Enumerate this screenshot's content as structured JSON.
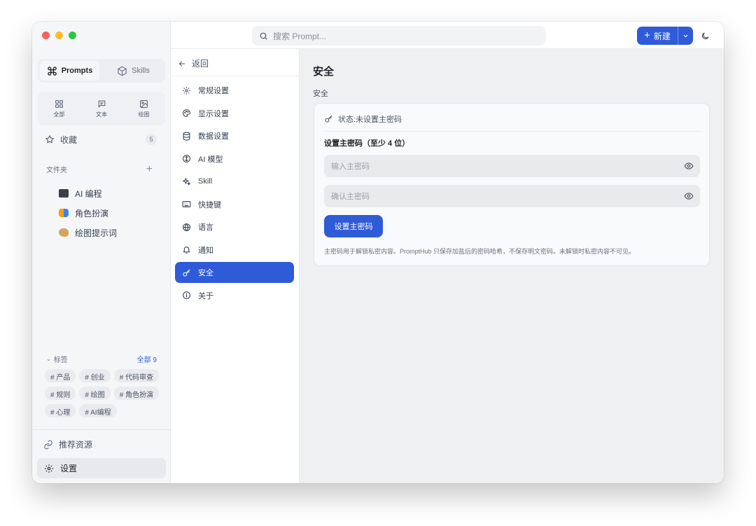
{
  "sidebar": {
    "mode_tabs": [
      {
        "label": "Prompts",
        "icon": "command-icon",
        "active": true
      },
      {
        "label": "Skills",
        "icon": "cube-icon",
        "active": false
      }
    ],
    "type_filters": [
      {
        "label": "全部",
        "icon": "grid-icon"
      },
      {
        "label": "文本",
        "icon": "message-icon"
      },
      {
        "label": "绘图",
        "icon": "image-icon"
      }
    ],
    "favorites": {
      "label": "收藏",
      "count": "5",
      "icon": "star-icon"
    },
    "folders_title": "文件夹",
    "folders": [
      {
        "label": "AI 编程",
        "icon": "laptop-icon"
      },
      {
        "label": "角色扮演",
        "icon": "mask-icon"
      },
      {
        "label": "绘图提示词",
        "icon": "palette-icon"
      }
    ],
    "tags_title": "标签",
    "tags_all": "全部 9",
    "tags": [
      "# 产品",
      "# 创业",
      "# 代码审查",
      "# 规则",
      "# 绘图",
      "# 角色扮演",
      "# 心理",
      "# AI编程"
    ],
    "resources_label": "推荐资源",
    "settings_label": "设置"
  },
  "topbar": {
    "search_placeholder": "搜索 Prompt...",
    "new_label": "新建"
  },
  "settings_nav": {
    "back_label": "返回",
    "items": [
      {
        "label": "常规设置",
        "icon": "gear-icon"
      },
      {
        "label": "显示设置",
        "icon": "palette-icon"
      },
      {
        "label": "数据设置",
        "icon": "database-icon"
      },
      {
        "label": "AI 模型",
        "icon": "ai-icon"
      },
      {
        "label": "Skill",
        "icon": "sparkle-icon"
      },
      {
        "label": "快捷键",
        "icon": "keyboard-icon"
      },
      {
        "label": "语言",
        "icon": "globe-icon"
      },
      {
        "label": "通知",
        "icon": "bell-icon"
      },
      {
        "label": "安全",
        "icon": "key-icon",
        "active": true
      },
      {
        "label": "关于",
        "icon": "info-icon"
      }
    ]
  },
  "security": {
    "title": "安全",
    "section": "安全",
    "status": "状态:未设置主密码",
    "set_label": "设置主密码（至少 4 位）",
    "password_placeholder": "输入主密码",
    "confirm_placeholder": "确认主密码",
    "button": "设置主密码",
    "hint": "主密码用于解锁私密内容。PromptHub 只保存加盐后的密码哈希，不保存明文密码。未解锁时私密内容不可见。"
  },
  "colors": {
    "accent": "#2f5bd8",
    "sidebar_bg": "#f5f6f8",
    "content_bg": "#eff0f2"
  }
}
